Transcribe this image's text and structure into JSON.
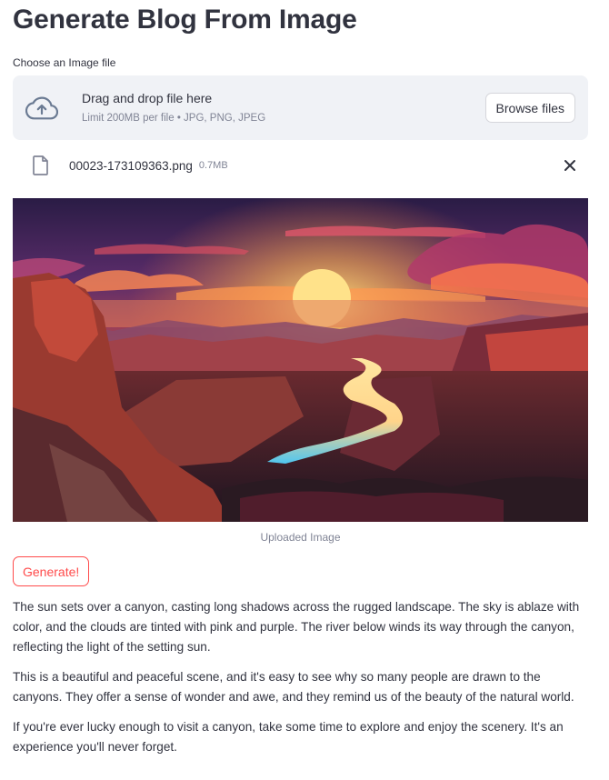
{
  "page": {
    "title": "Generate Blog From Image"
  },
  "uploader": {
    "label": "Choose an Image file",
    "instruction": "Drag and drop file here",
    "limit_text": "Limit 200MB per file • JPG, PNG, JPEG",
    "browse_label": "Browse files",
    "icon": "cloud-upload-icon"
  },
  "file": {
    "name": "00023-173109363.png",
    "size": "0.7MB",
    "icon": "file-icon",
    "remove_icon": "close-icon"
  },
  "image": {
    "caption": "Uploaded Image",
    "alt": "Uploaded Image"
  },
  "actions": {
    "generate_label": "Generate!"
  },
  "blog": {
    "paragraphs": [
      "The sun sets over a canyon, casting long shadows across the rugged landscape. The sky is ablaze with color, and the clouds are tinted with pink and purple. The river below winds its way through the canyon, reflecting the light of the setting sun.",
      "This is a beautiful and peaceful scene, and it's easy to see why so many people are drawn to the canyons. They offer a sense of wonder and awe, and they remind us of the beauty of the natural world.",
      "If you're ever lucky enough to visit a canyon, take some time to explore and enjoy the scenery. It's an experience you'll never forget."
    ]
  },
  "colors": {
    "accent": "#ff4b4b",
    "text": "#31333f",
    "muted": "#808495",
    "dropzone_bg": "#f0f2f6"
  }
}
